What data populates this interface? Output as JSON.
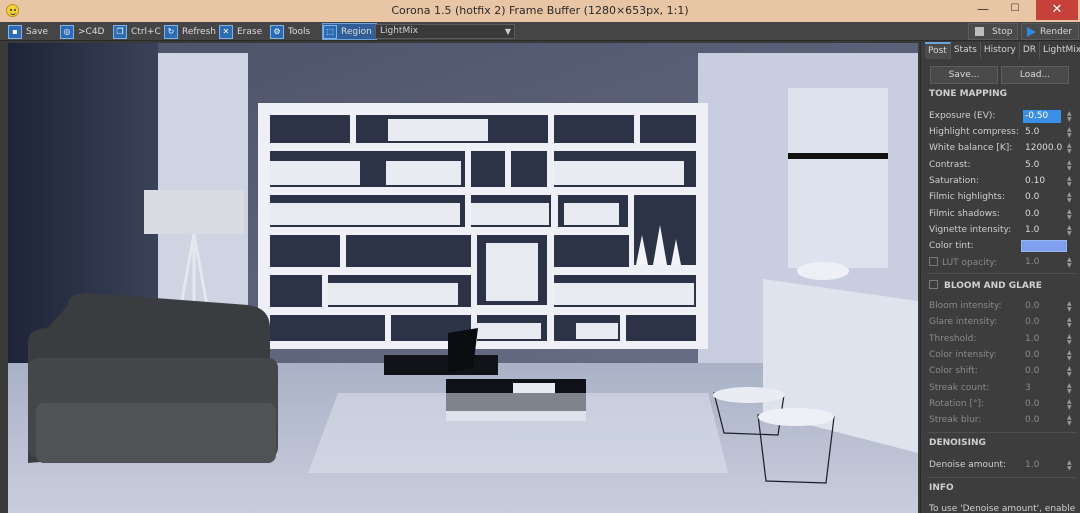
{
  "window": {
    "title": "Corona 1.5 (hotfix 2) Frame Buffer (1280×653px, 1:1)",
    "minimize": "—",
    "maximize": "☐",
    "close": "✕"
  },
  "toolbar": {
    "save": "Save",
    "c4d": ">C4D",
    "copy": "Ctrl+C",
    "refresh": "Refresh",
    "erase": "Erase",
    "tools": "Tools",
    "region": "Region",
    "lightmix_select": "LightMix",
    "stop": "Stop",
    "render": "Render"
  },
  "panel": {
    "tabs": [
      "Post",
      "Stats",
      "History",
      "DR",
      "LightMix"
    ],
    "save_btn": "Save...",
    "load_btn": "Load...",
    "tone_mapping": {
      "title": "TONE MAPPING",
      "rows": [
        {
          "label": "Exposure (EV):",
          "value": "-0.50"
        },
        {
          "label": "Highlight compress:",
          "value": "5.0"
        },
        {
          "label": "White balance [K]:",
          "value": "12000.0"
        },
        {
          "label": "Contrast:",
          "value": "5.0"
        },
        {
          "label": "Saturation:",
          "value": "0.10"
        },
        {
          "label": "Filmic highlights:",
          "value": "0.0"
        },
        {
          "label": "Filmic shadows:",
          "value": "0.0"
        },
        {
          "label": "Vignette intensity:",
          "value": "1.0"
        }
      ],
      "color_tint_label": "Color tint:",
      "color_tint": "#7f9fef",
      "lut_label": "LUT opacity:",
      "lut_value": "1.0"
    },
    "bloom": {
      "title": "BLOOM AND GLARE",
      "rows": [
        {
          "label": "Bloom intensity:",
          "value": "0.0"
        },
        {
          "label": "Glare intensity:",
          "value": "0.0"
        },
        {
          "label": "Threshold:",
          "value": "1.0"
        },
        {
          "label": "Color intensity:",
          "value": "0.0"
        },
        {
          "label": "Color shift:",
          "value": "0.0"
        },
        {
          "label": "Streak count:",
          "value": "3"
        },
        {
          "label": "Rotation [°]:",
          "value": "0.0"
        },
        {
          "label": "Streak blur:",
          "value": "0.0"
        }
      ]
    },
    "denoising": {
      "title": "DENOISING",
      "label": "Denoise amount:",
      "value": "1.0"
    },
    "info": {
      "title": "INFO",
      "text": "To use 'Denoise amount', enable"
    }
  }
}
